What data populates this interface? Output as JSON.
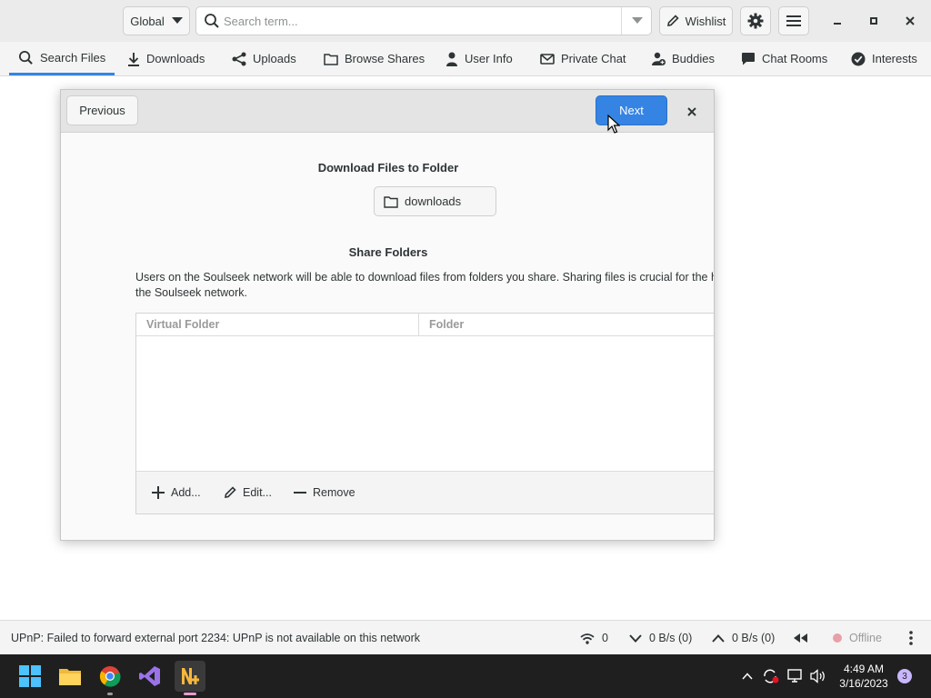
{
  "header": {
    "scope_select": "Global",
    "search_placeholder": "Search term...",
    "wishlist_label": "Wishlist"
  },
  "tabs": [
    {
      "label": "Search Files",
      "icon": "search-icon",
      "active": true
    },
    {
      "label": "Downloads",
      "icon": "download-icon"
    },
    {
      "label": "Uploads",
      "icon": "share-icon"
    },
    {
      "label": "Browse Shares",
      "icon": "folder-icon"
    },
    {
      "label": "User Info",
      "icon": "user-icon"
    },
    {
      "label": "Private Chat",
      "icon": "envelope-icon"
    },
    {
      "label": "Buddies",
      "icon": "buddies-icon"
    },
    {
      "label": "Chat Rooms",
      "icon": "chat-bubble-icon"
    },
    {
      "label": "Interests",
      "icon": "check-circle-icon"
    }
  ],
  "dialog": {
    "previous_label": "Previous",
    "next_label": "Next",
    "download_title": "Download Files to Folder",
    "download_folder": "downloads",
    "share_title": "Share Folders",
    "share_description_line1": "Users on the Soulseek network will be able to download files from folders you share. Sharing files is crucial for the health of",
    "share_description_line2": "the Soulseek network.",
    "columns": [
      "Virtual Folder",
      "Folder"
    ],
    "rows": [],
    "add_label": "Add...",
    "edit_label": "Edit...",
    "remove_label": "Remove"
  },
  "statusbar": {
    "message": "UPnP: Failed to forward external port 2234: UPnP is not available on this network",
    "connections": "0",
    "download_speed": "0 B/s (0)",
    "upload_speed": "0 B/s (0)",
    "status": "Offline",
    "status_color": "#e8a0a8"
  },
  "taskbar": {
    "time": "4:49 AM",
    "date": "3/16/2023",
    "notification_count": "3",
    "accent": "#3584e4"
  }
}
